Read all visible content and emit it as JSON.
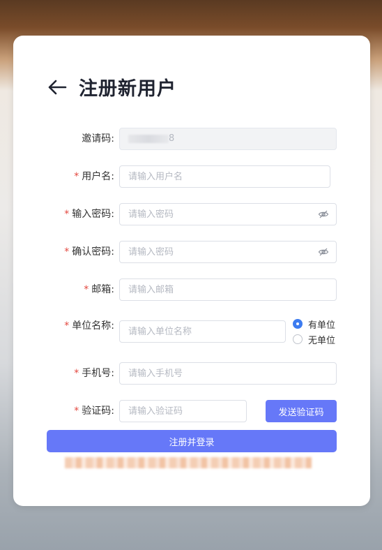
{
  "page": {
    "title": "注册新用户",
    "back_icon": "arrow-left-icon"
  },
  "form": {
    "required_mark": "*",
    "invite_code": {
      "label": "邀请码:",
      "value_suffix": "8"
    },
    "username": {
      "label": "用户名:",
      "placeholder": "请输入用户名"
    },
    "password": {
      "label": "输入密码:",
      "placeholder": "请输入密码",
      "icon": "eye-off-icon"
    },
    "confirm_password": {
      "label": "确认密码:",
      "placeholder": "请输入密码",
      "icon": "eye-off-icon"
    },
    "email": {
      "label": "邮箱:",
      "placeholder": "请输入邮箱"
    },
    "organization": {
      "label": "单位名称:",
      "placeholder": "请输入单位名称",
      "options": [
        "有单位",
        "无单位"
      ],
      "selected": "有单位"
    },
    "phone": {
      "label": "手机号:",
      "placeholder": "请输入手机号"
    },
    "verification": {
      "label": "验证码:",
      "placeholder": "请输入验证码",
      "send_label": "发送验证码"
    },
    "submit_label": "注册并登录"
  },
  "colors": {
    "primary": "#6678f8",
    "radio_selected": "#3d7cf0",
    "required": "#e3473f",
    "title": "#1f2330"
  }
}
